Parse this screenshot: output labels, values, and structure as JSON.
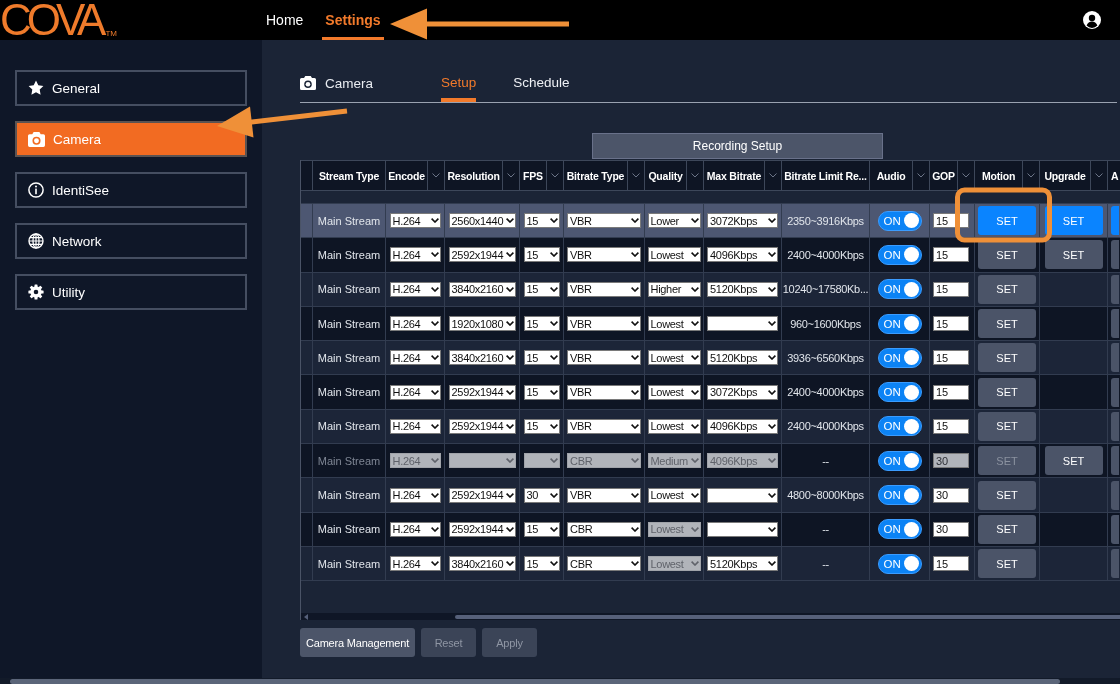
{
  "header": {
    "logo": "COVA",
    "logo_mark": "TM",
    "nav": [
      {
        "label": "Home",
        "selected": false
      },
      {
        "label": "Settings",
        "selected": true
      }
    ]
  },
  "sidebar": {
    "items": [
      {
        "label": "General",
        "selected": false
      },
      {
        "label": "Camera",
        "selected": true
      },
      {
        "label": "IdentiSee",
        "selected": false
      },
      {
        "label": "Network",
        "selected": false
      },
      {
        "label": "Utility",
        "selected": false
      }
    ]
  },
  "tabs": {
    "section": "Camera",
    "items": [
      {
        "label": "Setup",
        "selected": true
      },
      {
        "label": "Schedule",
        "selected": false
      }
    ]
  },
  "table": {
    "group_header": "Recording Setup",
    "columns": [
      {
        "label": "Stream Type",
        "menu": false
      },
      {
        "label": "Encode",
        "menu": true
      },
      {
        "label": "Resolution",
        "menu": true
      },
      {
        "label": "FPS",
        "menu": true
      },
      {
        "label": "Bitrate Type",
        "menu": true
      },
      {
        "label": "Quality",
        "menu": true
      },
      {
        "label": "Max Bitrate",
        "menu": true
      },
      {
        "label": "Bitrate Limit Re...",
        "menu": false
      },
      {
        "label": "Audio",
        "menu": true
      },
      {
        "label": "GOP",
        "menu": true
      },
      {
        "label": "Motion",
        "menu": true
      },
      {
        "label": "Upgrade",
        "menu": true
      },
      {
        "label": "A",
        "menu": false
      }
    ],
    "rows": [
      {
        "stream_type": "Main Stream",
        "selected": true,
        "disabled": false,
        "encode": {
          "value": "H.264",
          "disabled": false
        },
        "resolution": {
          "value": "2560x1440",
          "disabled": false
        },
        "fps": {
          "value": "15",
          "disabled": false
        },
        "bitrate_type": {
          "value": "VBR",
          "disabled": false
        },
        "quality": {
          "value": "Lower",
          "disabled": false
        },
        "max_bitrate": {
          "value": "3072Kbps",
          "disabled": false
        },
        "bitrate_limit": "2350~3916Kbps",
        "audio": {
          "label": "ON",
          "on": true
        },
        "gop": {
          "value": "15",
          "disabled": false
        },
        "motion": {
          "label": "SET",
          "disabled": false
        },
        "upgrade": {
          "label": "SET",
          "disabled": false
        }
      },
      {
        "stream_type": "Main Stream",
        "selected": false,
        "disabled": false,
        "encode": {
          "value": "H.264",
          "disabled": false
        },
        "resolution": {
          "value": "2592x1944",
          "disabled": false
        },
        "fps": {
          "value": "15",
          "disabled": false
        },
        "bitrate_type": {
          "value": "VBR",
          "disabled": false
        },
        "quality": {
          "value": "Lowest",
          "disabled": false
        },
        "max_bitrate": {
          "value": "4096Kbps",
          "disabled": false
        },
        "bitrate_limit": "2400~4000Kbps",
        "audio": {
          "label": "ON",
          "on": true
        },
        "gop": {
          "value": "15",
          "disabled": false
        },
        "motion": {
          "label": "SET",
          "disabled": false
        },
        "upgrade": {
          "label": "SET",
          "disabled": false
        }
      },
      {
        "stream_type": "Main Stream",
        "selected": false,
        "disabled": false,
        "encode": {
          "value": "H.264",
          "disabled": false
        },
        "resolution": {
          "value": "3840x2160",
          "disabled": false
        },
        "fps": {
          "value": "15",
          "disabled": false
        },
        "bitrate_type": {
          "value": "VBR",
          "disabled": false
        },
        "quality": {
          "value": "Higher",
          "disabled": false
        },
        "max_bitrate": {
          "value": "5120Kbps",
          "disabled": false
        },
        "bitrate_limit": "10240~17580Kb...",
        "audio": {
          "label": "ON",
          "on": true
        },
        "gop": {
          "value": "15",
          "disabled": false
        },
        "motion": {
          "label": "SET",
          "disabled": false
        }
      },
      {
        "stream_type": "Main Stream",
        "selected": false,
        "disabled": false,
        "encode": {
          "value": "H.264",
          "disabled": false
        },
        "resolution": {
          "value": "1920x1080",
          "disabled": false
        },
        "fps": {
          "value": "15",
          "disabled": false
        },
        "bitrate_type": {
          "value": "VBR",
          "disabled": false
        },
        "quality": {
          "value": "Lowest",
          "disabled": false
        },
        "max_bitrate": {
          "disabled": false
        },
        "bitrate_limit": "960~1600Kbps",
        "audio": {
          "label": "ON",
          "on": true
        },
        "gop": {
          "value": "15",
          "disabled": false
        },
        "motion": {
          "label": "SET",
          "disabled": false
        }
      },
      {
        "stream_type": "Main Stream",
        "selected": false,
        "disabled": false,
        "encode": {
          "value": "H.264",
          "disabled": false
        },
        "resolution": {
          "value": "3840x2160",
          "disabled": false
        },
        "fps": {
          "value": "15",
          "disabled": false
        },
        "bitrate_type": {
          "value": "VBR",
          "disabled": false
        },
        "quality": {
          "value": "Lowest",
          "disabled": false
        },
        "max_bitrate": {
          "value": "5120Kbps",
          "disabled": false
        },
        "bitrate_limit": "3936~6560Kbps",
        "audio": {
          "label": "ON",
          "on": true
        },
        "gop": {
          "value": "15",
          "disabled": false
        },
        "motion": {
          "label": "SET",
          "disabled": false
        }
      },
      {
        "stream_type": "Main Stream",
        "selected": false,
        "disabled": false,
        "encode": {
          "value": "H.264",
          "disabled": false
        },
        "resolution": {
          "value": "2592x1944",
          "disabled": false
        },
        "fps": {
          "value": "15",
          "disabled": false
        },
        "bitrate_type": {
          "value": "VBR",
          "disabled": false
        },
        "quality": {
          "value": "Lowest",
          "disabled": false
        },
        "max_bitrate": {
          "value": "3072Kbps",
          "disabled": false
        },
        "bitrate_limit": "2400~4000Kbps",
        "audio": {
          "label": "ON",
          "on": true
        },
        "gop": {
          "value": "15",
          "disabled": false
        },
        "motion": {
          "label": "SET",
          "disabled": false
        }
      },
      {
        "stream_type": "Main Stream",
        "selected": false,
        "disabled": false,
        "encode": {
          "value": "H.264",
          "disabled": false
        },
        "resolution": {
          "value": "2592x1944",
          "disabled": false
        },
        "fps": {
          "value": "15",
          "disabled": false
        },
        "bitrate_type": {
          "value": "VBR",
          "disabled": false
        },
        "quality": {
          "value": "Lowest",
          "disabled": false
        },
        "max_bitrate": {
          "value": "4096Kbps",
          "disabled": false
        },
        "bitrate_limit": "2400~4000Kbps",
        "audio": {
          "label": "ON",
          "on": true
        },
        "gop": {
          "value": "15",
          "disabled": false
        },
        "motion": {
          "label": "SET",
          "disabled": false
        }
      },
      {
        "stream_type": "Main Stream",
        "selected": false,
        "disabled": true,
        "encode": {
          "value": "H.264",
          "disabled": true
        },
        "resolution": {
          "disabled": true
        },
        "fps": {
          "disabled": true
        },
        "bitrate_type": {
          "value": "CBR",
          "disabled": true
        },
        "quality": {
          "value": "Medium",
          "disabled": true
        },
        "max_bitrate": {
          "value": "4096Kbps",
          "disabled": true
        },
        "bitrate_limit": "--",
        "audio": {
          "label": "ON",
          "on": true
        },
        "gop": {
          "value": "30",
          "disabled": true
        },
        "motion": {
          "label": "SET",
          "disabled": true
        },
        "upgrade": {
          "label": "SET",
          "disabled": false
        }
      },
      {
        "stream_type": "Main Stream",
        "selected": false,
        "disabled": false,
        "encode": {
          "value": "H.264",
          "disabled": false
        },
        "resolution": {
          "value": "2592x1944",
          "disabled": false
        },
        "fps": {
          "value": "30",
          "disabled": false
        },
        "bitrate_type": {
          "value": "VBR",
          "disabled": false
        },
        "quality": {
          "value": "Lowest",
          "disabled": false
        },
        "max_bitrate": {
          "disabled": false
        },
        "bitrate_limit": "4800~8000Kbps",
        "audio": {
          "label": "ON",
          "on": true
        },
        "gop": {
          "value": "30",
          "disabled": false
        },
        "motion": {
          "label": "SET",
          "disabled": false
        }
      },
      {
        "stream_type": "Main Stream",
        "selected": false,
        "disabled": false,
        "encode": {
          "value": "H.264",
          "disabled": false
        },
        "resolution": {
          "value": "2592x1944",
          "disabled": false
        },
        "fps": {
          "value": "15",
          "disabled": false
        },
        "bitrate_type": {
          "value": "CBR",
          "disabled": false
        },
        "quality": {
          "value": "Lowest",
          "disabled": true
        },
        "max_bitrate": {
          "disabled": false
        },
        "bitrate_limit": "--",
        "audio": {
          "label": "ON",
          "on": true
        },
        "gop": {
          "value": "30",
          "disabled": false
        },
        "motion": {
          "label": "SET",
          "disabled": false
        }
      },
      {
        "stream_type": "Main Stream",
        "selected": false,
        "disabled": false,
        "encode": {
          "value": "H.264",
          "disabled": false
        },
        "resolution": {
          "value": "3840x2160",
          "disabled": false
        },
        "fps": {
          "value": "15",
          "disabled": false
        },
        "bitrate_type": {
          "value": "CBR",
          "disabled": false
        },
        "quality": {
          "value": "Lowest",
          "disabled": true
        },
        "max_bitrate": {
          "value": "5120Kbps",
          "disabled": false
        },
        "bitrate_limit": "--",
        "audio": {
          "label": "ON",
          "on": true
        },
        "gop": {
          "value": "15",
          "disabled": false
        },
        "motion": {
          "label": "SET",
          "disabled": false
        }
      }
    ]
  },
  "buttons": [
    {
      "label": "Camera Management",
      "disabled": false
    },
    {
      "label": "Reset",
      "disabled": true
    },
    {
      "label": "Apply",
      "disabled": true
    }
  ]
}
